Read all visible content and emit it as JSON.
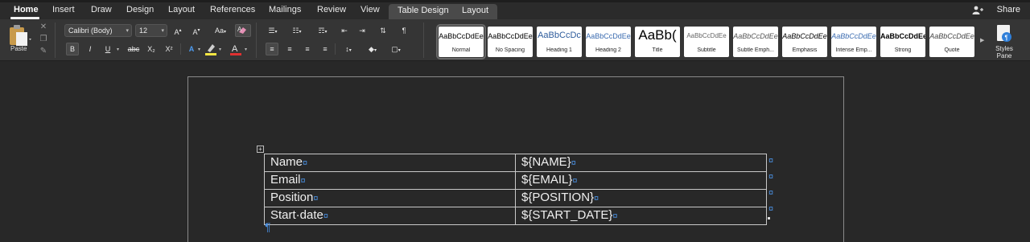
{
  "tabs": [
    "Home",
    "Insert",
    "Draw",
    "Design",
    "Layout",
    "References",
    "Mailings",
    "Review",
    "View"
  ],
  "context_tabs": [
    "Table Design",
    "Layout"
  ],
  "share_label": "Share",
  "ribbon": {
    "paste_label": "Paste",
    "font_name": "Calibri (Body)",
    "font_size": "12",
    "bold": "B",
    "italic": "I",
    "underline": "U",
    "strike": "abc",
    "subscript": "X₂",
    "superscript": "X²",
    "font_color_letter": "A",
    "styles_pane_label_1": "Styles",
    "styles_pane_label_2": "Pane",
    "highlight_color": "#f5e642",
    "font_color": "#e03131"
  },
  "styles": [
    {
      "sample": "AaBbCcDdEe",
      "name": "Normal"
    },
    {
      "sample": "AaBbCcDdEe",
      "name": "No Spacing"
    },
    {
      "sample": "AaBbCcDc",
      "name": "Heading 1"
    },
    {
      "sample": "AaBbCcDdEe",
      "name": "Heading 2"
    },
    {
      "sample": "AaBb(",
      "name": "Title"
    },
    {
      "sample": "AaBbCcDdEe",
      "name": "Subtitle"
    },
    {
      "sample": "AaBbCcDdEe",
      "name": "Subtle Emph..."
    },
    {
      "sample": "AaBbCcDdEe",
      "name": "Emphasis"
    },
    {
      "sample": "AaBbCcDdEe",
      "name": "Intense Emp..."
    },
    {
      "sample": "AaBbCcDdEe",
      "name": "Strong"
    },
    {
      "sample": "AaBbCcDdEe",
      "name": "Quote"
    }
  ],
  "table": {
    "rows": [
      {
        "label": "Name",
        "value": "${NAME}"
      },
      {
        "label": "Email",
        "value": "${EMAIL}"
      },
      {
        "label": "Position",
        "value": "${POSITION}"
      },
      {
        "label": "Start·date",
        "value": "${START_DATE}"
      }
    ]
  },
  "marks": {
    "cell_end": "¤",
    "paragraph": "¶"
  }
}
